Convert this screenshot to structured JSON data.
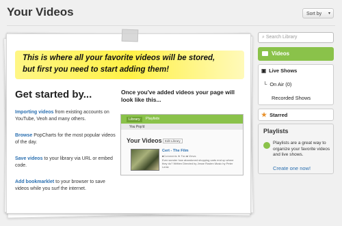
{
  "header": {
    "title": "Your Videos",
    "sort_label": "Sort by",
    "sort_arrow": "▾"
  },
  "intro": {
    "line1": "This is where all your favorite videos will be stored,",
    "line2": "but first you need to start adding them!"
  },
  "get_started": {
    "heading": "Get started by...",
    "tips": [
      {
        "link": "Importing videos",
        "text": " from existing accounts on YouTube, Veoh and many others."
      },
      {
        "link": "Browse",
        "text": " PopCharts for the most popular videos of the day."
      },
      {
        "link": "Save videos",
        "text": " to your library via URL or embed code."
      },
      {
        "link": "Add bookmarklet",
        "text": " to your browser to save videos while you surf the internet."
      }
    ]
  },
  "preview": {
    "heading": "Once you've added videos your page will look like this...",
    "tabs": [
      "Library",
      "Playlists"
    ],
    "sub_item": "You Pop'd",
    "title": "Your Videos",
    "edit_label": "Edit Library",
    "video_title": "Cert - The Film",
    "video_meta": "■Comments ★ Fav ■ Views",
    "video_desc": "Ever wonder how abandoned shopping carts end up where they do? Written Directed by Jesse Rosten Music by Peter Lentz"
  },
  "sidebar": {
    "search_placeholder": "Search Library",
    "videos_label": "Videos",
    "live_shows_label": "Live Shows",
    "on_air_label": "On Air (0)",
    "recorded_label": "Recorded Shows",
    "starred_label": "Starred",
    "playlists_heading": "Playlists",
    "playlists_text": "Playlists are a great way to organize your favorite videos and live shows.",
    "create_link": "Create one now!"
  },
  "colors": {
    "accent_green": "#8ac24a",
    "link_blue": "#2a6fb0",
    "highlight_yellow": "#fff03c"
  }
}
